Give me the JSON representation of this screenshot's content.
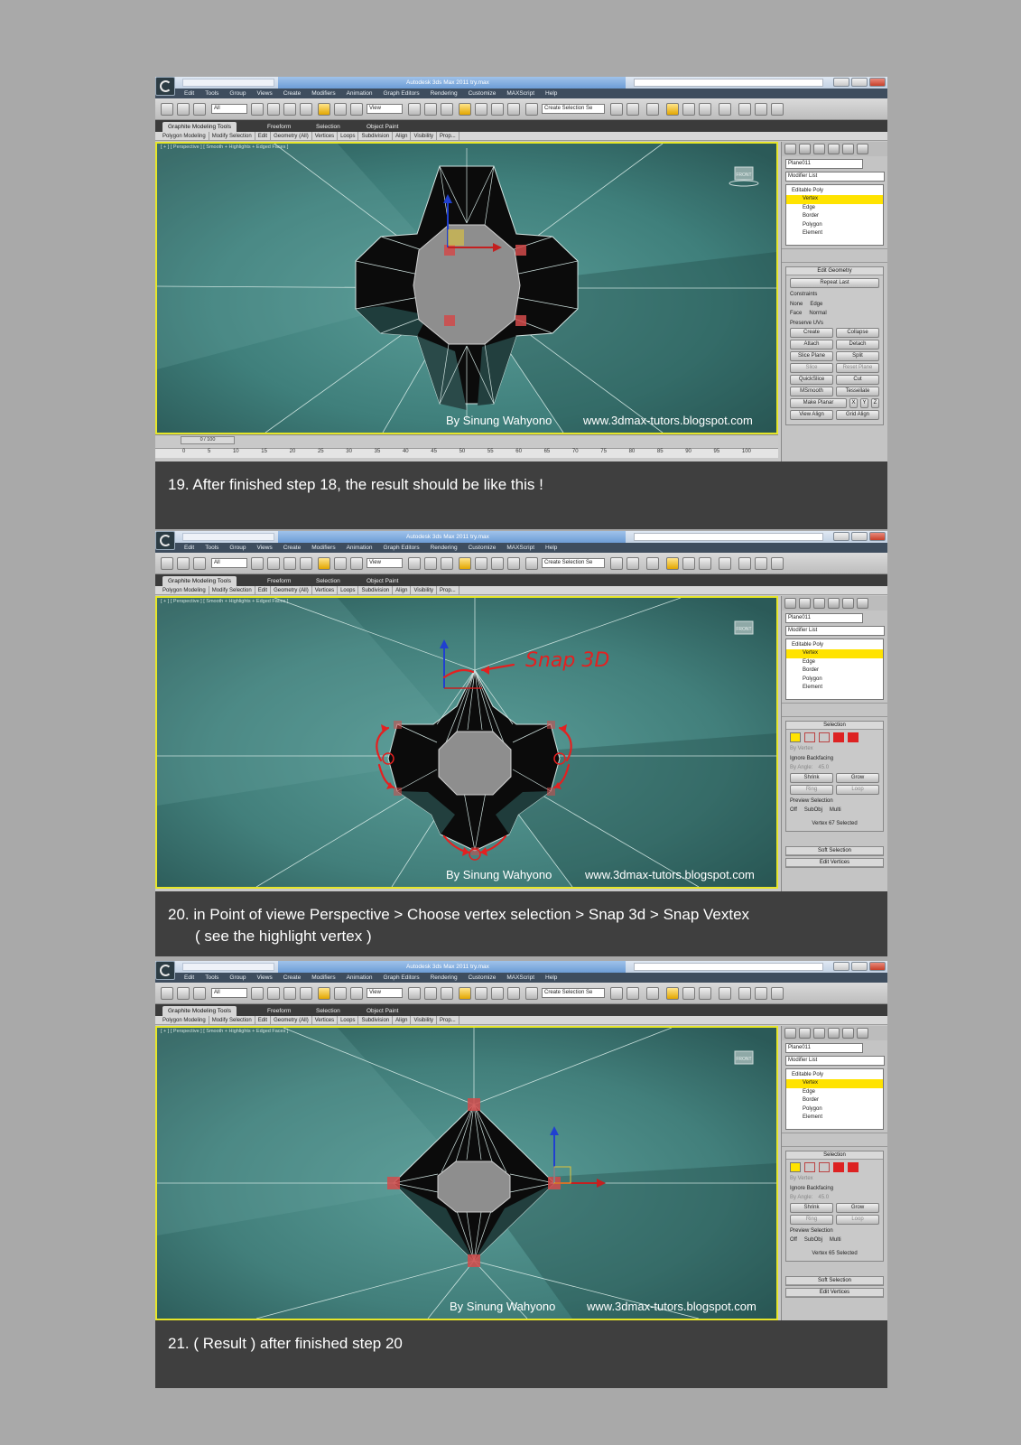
{
  "app": {
    "title": "Autodesk 3ds Max  2011     try.max",
    "menu": [
      "Edit",
      "Tools",
      "Group",
      "Views",
      "Create",
      "Modifiers",
      "Animation",
      "Graph Editors",
      "Rendering",
      "Customize",
      "MAXScript",
      "Help"
    ],
    "toolbar": {
      "filter": "All",
      "coord": "View",
      "selection_set": "Create Selection Se"
    },
    "graphite_tabs": [
      "Graphite Modeling Tools",
      "Freeform",
      "Selection",
      "Object Paint"
    ],
    "ribbon": [
      "Polygon Modeling",
      "Modify Selection",
      "Edit",
      "Geometry (All)",
      "Vertices",
      "Loops",
      "Subdivision",
      "Align",
      "Visibility",
      "Prop..."
    ],
    "viewport_label": "[ + ] [ Perspective ] [ Smooth + Highlights + Edged Faces ]",
    "viewcube_label": "FRONT",
    "object_name": "Plane011",
    "modifier_list": "Modifier List",
    "stack": [
      "Editable Poly",
      "Vertex",
      "Edge",
      "Border",
      "Polygon",
      "Element"
    ]
  },
  "credit": {
    "author": "By Sinung Wahyono",
    "site": "www.3dmax-tutors.blogspot.com"
  },
  "panel1": {
    "caption": "19.  After finished step 18, the result should be like this !",
    "edit_geometry": {
      "header": "Edit Geometry",
      "repeat_last": "Repeat Last",
      "constraints": "Constraints",
      "none": "None",
      "edge": "Edge",
      "face": "Face",
      "normal": "Normal",
      "preserve_uvs": "Preserve UVs",
      "create": "Create",
      "collapse": "Collapse",
      "attach": "Attach",
      "detach": "Detach",
      "slice_plane": "Slice Plane",
      "split": "Split",
      "slice": "Slice",
      "reset_plane": "Reset Plane",
      "quickslice": "QuickSlice",
      "cut": "Cut",
      "msmooth": "MSmooth",
      "tessellate": "Tessellate",
      "make_planar": "Make Planar",
      "x": "X",
      "y": "Y",
      "z": "Z",
      "view_align": "View Align",
      "grid_align": "Grid Align"
    },
    "timeline": {
      "frame": "0 / 100",
      "ticks": [
        "0",
        "5",
        "10",
        "15",
        "20",
        "25",
        "30",
        "35",
        "40",
        "45",
        "50",
        "55",
        "60",
        "65",
        "70",
        "75",
        "80",
        "85",
        "90",
        "95",
        "100"
      ]
    }
  },
  "panel2": {
    "caption_line1": "20. in Point of viewe Perspective  > Choose vertex selection > Snap 3d > Snap Vextex",
    "caption_line2": "( see the highlight vertex )",
    "annotation": "Snap 3D",
    "selection": {
      "header": "Selection",
      "by_vertex": "By Vertex",
      "ignore_backfacing": "Ignore Backfacing",
      "by_angle": "By Angle:",
      "angle_value": "45.0",
      "shrink": "Shrink",
      "grow": "Grow",
      "ring": "Ring",
      "loop": "Loop",
      "preview": "Preview Selection",
      "off": "Off",
      "subobj": "SubObj",
      "multi": "Multi",
      "status": "Vertex 67 Selected"
    },
    "soft_selection": "Soft Selection",
    "edit_vertices": "Edit Vertices"
  },
  "panel3": {
    "caption": "21. ( Result ) after finished step 20",
    "selection": {
      "header": "Selection",
      "by_vertex": "By Vertex",
      "ignore_backfacing": "Ignore Backfacing",
      "by_angle": "By Angle:",
      "angle_value": "45.0",
      "shrink": "Shrink",
      "grow": "Grow",
      "ring": "Ring",
      "loop": "Loop",
      "preview": "Preview Selection",
      "off": "Off",
      "subobj": "SubObj",
      "multi": "Multi",
      "status": "Vertex 65 Selected"
    },
    "soft_selection": "Soft Selection",
    "edit_vertices": "Edit Vertices"
  },
  "colors": {
    "viewport": "#4e8d89",
    "viewport_border": "#e6e62a",
    "selected_vertex": "#d24b4b",
    "caption_bg": "#3f3f3f",
    "annotation": "#e42020"
  }
}
